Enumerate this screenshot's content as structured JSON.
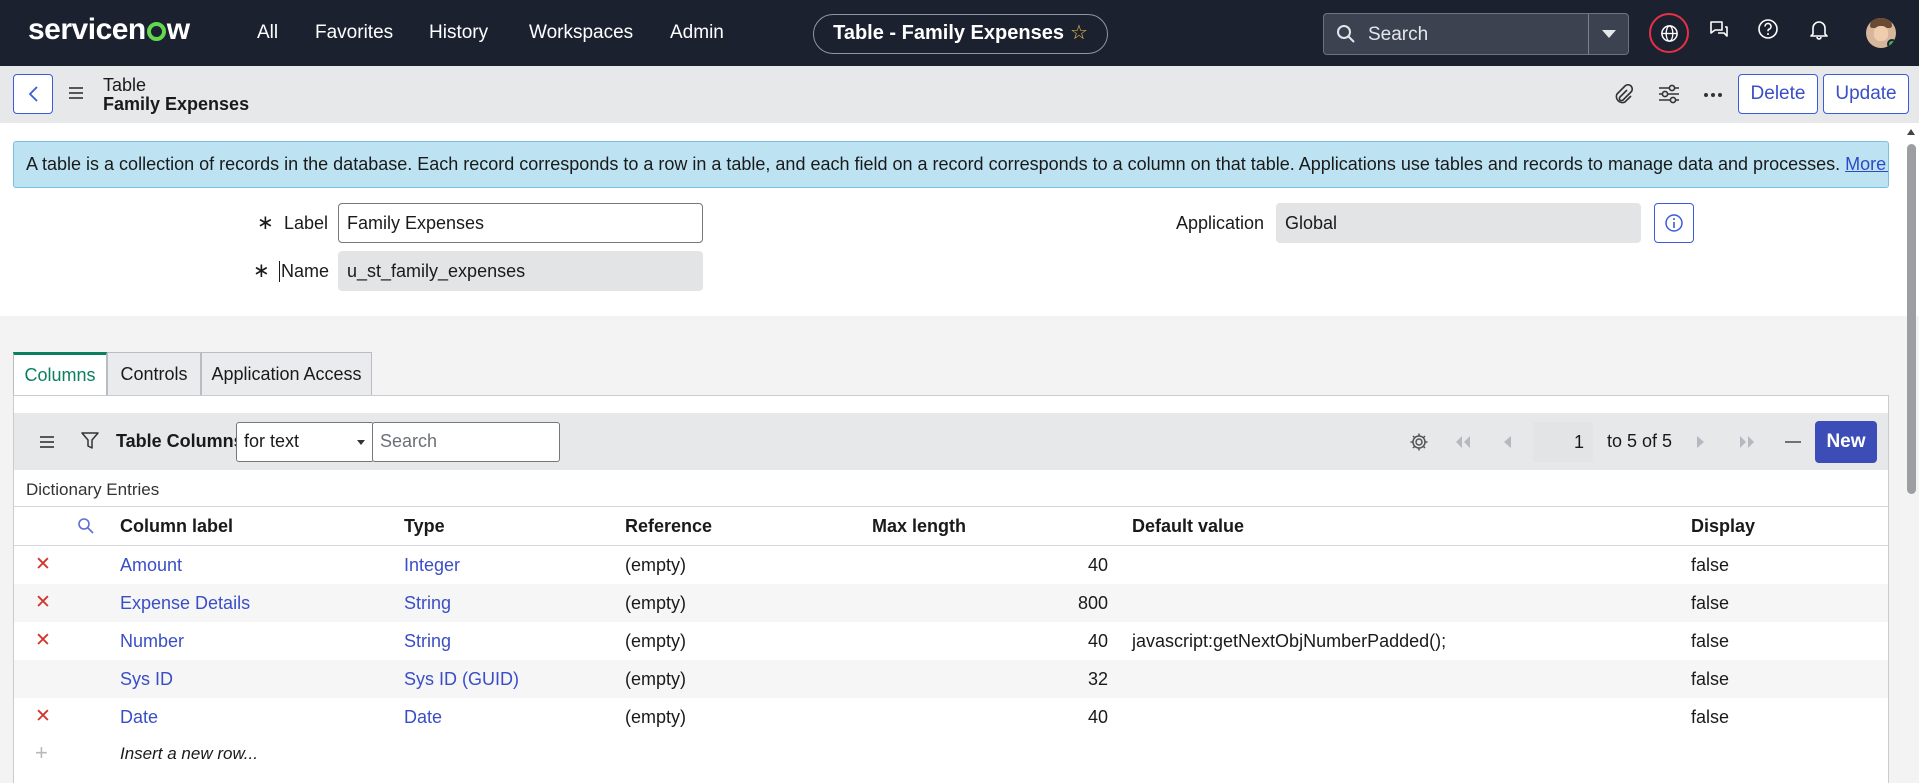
{
  "topbar": {
    "logo_text": "servicenow",
    "nav": [
      "All",
      "Favorites",
      "History",
      "Workspaces",
      "Admin"
    ],
    "record_title": "Table - Family Expenses",
    "search_placeholder": "Search"
  },
  "header": {
    "record_type": "Table",
    "record_name": "Family Expenses",
    "delete_label": "Delete",
    "update_label": "Update"
  },
  "info": {
    "text": "A table is a collection of records in the database. Each record corresponds to a row in a table, and each field on a record corresponds to a column on that table. Applications use tables and records to manage data and processes.",
    "link": "More Info"
  },
  "form": {
    "label_label": "Label",
    "label_value": "Family Expenses",
    "name_label": "Name",
    "name_value": "u_st_family_expenses",
    "application_label": "Application",
    "application_value": "Global"
  },
  "tabs": [
    {
      "label": "Columns",
      "active": true
    },
    {
      "label": "Controls",
      "active": false
    },
    {
      "label": "Application Access",
      "active": false
    }
  ],
  "list": {
    "title": "Table Columns",
    "filter_select": "for text",
    "search_placeholder": "Search",
    "page_value": "1",
    "page_text": "to 5 of 5",
    "new_label": "New",
    "breadcrumb": "Dictionary Entries",
    "columns": [
      "Column label",
      "Type",
      "Reference",
      "Max length",
      "Default value",
      "Display"
    ],
    "rows": [
      {
        "label": "Amount",
        "type": "Integer",
        "reference": "(empty)",
        "max_length": "40",
        "default": "",
        "display": "false",
        "deletable": true
      },
      {
        "label": "Expense Details",
        "type": "String",
        "reference": "(empty)",
        "max_length": "800",
        "default": "",
        "display": "false",
        "deletable": true
      },
      {
        "label": "Number",
        "type": "String",
        "reference": "(empty)",
        "max_length": "40",
        "default": "javascript:getNextObjNumberPadded();",
        "display": "false",
        "deletable": true
      },
      {
        "label": "Sys ID",
        "type": "Sys ID (GUID)",
        "reference": "(empty)",
        "max_length": "32",
        "default": "",
        "display": "false",
        "deletable": false
      },
      {
        "label": "Date",
        "type": "Date",
        "reference": "(empty)",
        "max_length": "40",
        "default": "",
        "display": "false",
        "deletable": true
      }
    ],
    "insert_row": "Insert a new row..."
  },
  "colors": {
    "topbar_bg": "#1c2130",
    "accent": "#3b5bdb",
    "active_tab": "#0b7f5f",
    "delete_x": "#d1352b",
    "info_bg": "#bde3f3"
  }
}
